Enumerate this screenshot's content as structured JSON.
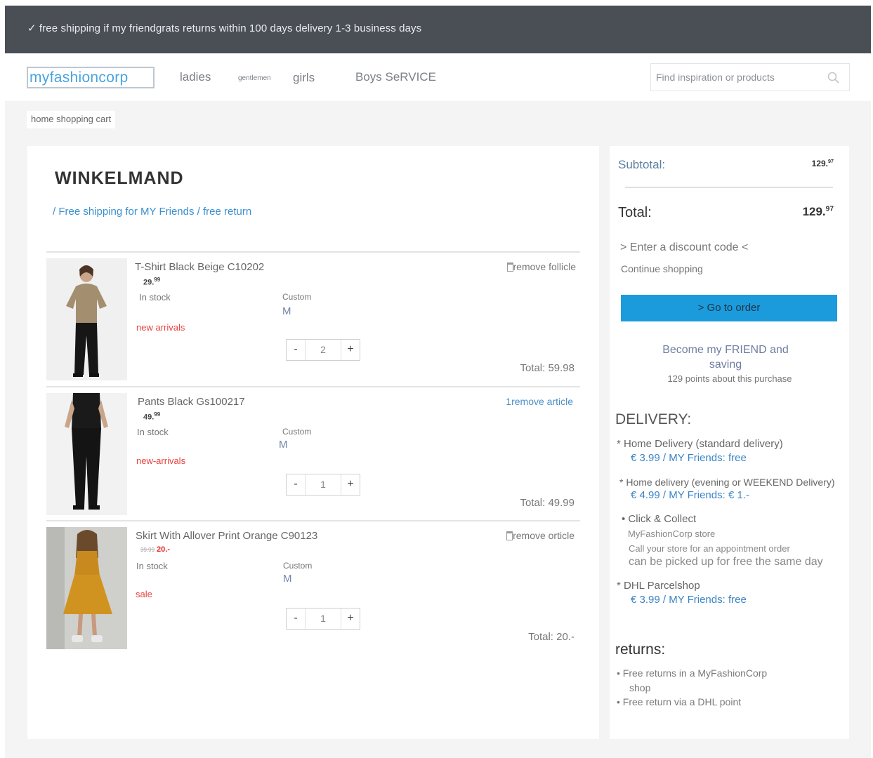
{
  "topbar": {
    "message": "✓ free shipping if my friendgrats returns within 100 days delivery 1-3 business days"
  },
  "nav": {
    "logo": "myfashioncorp",
    "items": [
      "ladies",
      "gentlemen",
      "girls",
      "Boys SeRVICE"
    ],
    "search_placeholder": "Find inspiration or products"
  },
  "breadcrumb": "home shopping cart",
  "cart": {
    "title": "WINKELMAND",
    "subtitle": "/ Free shipping for MY Friends / free return",
    "items": [
      {
        "name": "T-Shirt Black Beige C10202",
        "price_main": "29.",
        "price_sup": "99",
        "old_price": "",
        "stock": "In stock",
        "tag": "new arrivals",
        "size_label": "Custom",
        "size_value": "M",
        "remove": "remove follicle",
        "qty": "2",
        "total": "Total: 59.98"
      },
      {
        "name": "Pants Black Gs100217",
        "price_main": "49.",
        "price_sup": "99",
        "old_price": "",
        "stock": "In stock",
        "tag": "new-arrivals",
        "size_label": "Custom",
        "size_value": "M",
        "remove": "1remove article",
        "qty": "1",
        "total": "Total: 49.99"
      },
      {
        "name": "Skirt With Allover Print Orange C90123",
        "price_main": "20.-",
        "price_sup": "",
        "old_price": "39.99",
        "stock": "In stock",
        "tag": "sale",
        "size_label": "Custom",
        "size_value": "M",
        "remove": "remove orticle",
        "qty": "1",
        "total": "Total: 20.-"
      }
    ],
    "qty_minus": "-",
    "qty_plus": "+"
  },
  "summary": {
    "subtotal_label": "Subtotal:",
    "subtotal_main": "129.",
    "subtotal_sup": "97",
    "total_label": "Total:",
    "total_main": "129.",
    "total_sup": "97",
    "discount": "> Enter a discount code <",
    "continue": "Continue shopping",
    "order_button": "> Go to order",
    "become_line1": "Become my FRIEND and",
    "become_line2": "saving",
    "points": "129 points about this purchase"
  },
  "delivery": {
    "title": "DELIVERY:",
    "home_standard": "* Home Delivery (standard delivery)",
    "home_standard_price": "€ 3.99 / MY Friends: free",
    "home_evening": "* Home delivery (evening or WEEKEND Delivery)",
    "home_evening_price": "€ 4.99 / MY Friends: € 1.-",
    "click_collect": "• Click & Collect",
    "store": "MyFashionCorp store",
    "call": "Call your store for an appointment order",
    "pickup": "can be picked up for free the same day",
    "dhl": "* DHL Parcelshop",
    "dhl_price": "€ 3.99 / MY Friends: free"
  },
  "returns": {
    "title": "returns:",
    "item1_line1": "• Free returns in a MyFashionCorp",
    "item1_line2": "shop",
    "item2": "• Free return via a DHL point"
  }
}
